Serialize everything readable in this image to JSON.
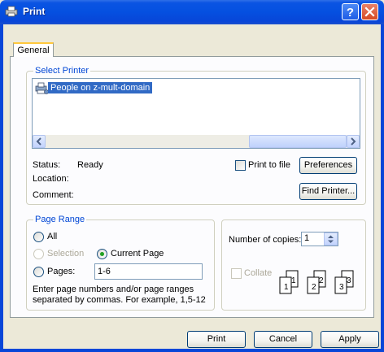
{
  "window": {
    "title": "Print"
  },
  "tabs": [
    {
      "label": "General"
    }
  ],
  "select_printer": {
    "legend": "Select Printer",
    "printers": [
      {
        "name": "People on z-mult-domain",
        "selected": true
      }
    ],
    "status_label": "Status:",
    "status_value": "Ready",
    "location_label": "Location:",
    "location_value": "",
    "comment_label": "Comment:",
    "comment_value": "",
    "print_to_file_label": "Print to file",
    "print_to_file_checked": false,
    "preferences_button": "Preferences",
    "find_printer_button": "Find Printer..."
  },
  "page_range": {
    "legend": "Page Range",
    "all_label": "All",
    "selection_label": "Selection",
    "current_page_label": "Current Page",
    "pages_label": "Pages:",
    "pages_value": "1-6",
    "selected_option": "current_page",
    "help_text": "Enter page numbers and/or page ranges separated by commas.  For example, 1,5-12"
  },
  "copies": {
    "number_label": "Number of copies:",
    "number_value": "1",
    "collate_label": "Collate",
    "collate_checked": false,
    "collate_pages": [
      "1",
      "1",
      "2",
      "2",
      "3",
      "3"
    ]
  },
  "footer": {
    "print_button": "Print",
    "cancel_button": "Cancel",
    "apply_button": "Apply"
  },
  "colors": {
    "titlebar": "#0550e0",
    "accent": "#0046d5",
    "selection": "#316ac5",
    "dialog_bg": "#ECE9D8"
  }
}
